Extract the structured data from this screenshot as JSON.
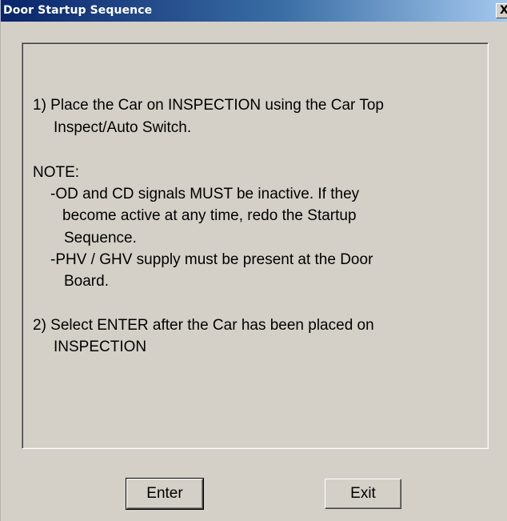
{
  "window": {
    "title": "Door Startup Sequence",
    "close_label": "X"
  },
  "content": {
    "lines": [
      "1)  Place the Car on INSPECTION using the Car Top",
      "Inspect/Auto Switch.",
      "NOTE:",
      "-OD and CD signals MUST be inactive.  If they",
      "become active at any time, redo the Startup",
      "Sequence.",
      "-PHV / GHV supply must be present at the Door",
      "Board.",
      "2)  Select ENTER after the Car has been placed on",
      "INSPECTION"
    ]
  },
  "buttons": {
    "enter_label": "Enter",
    "exit_label": "Exit"
  },
  "colors": {
    "titlebar_start": "#0a246a",
    "titlebar_end": "#a6caf0",
    "face": "#d4d0c8"
  }
}
